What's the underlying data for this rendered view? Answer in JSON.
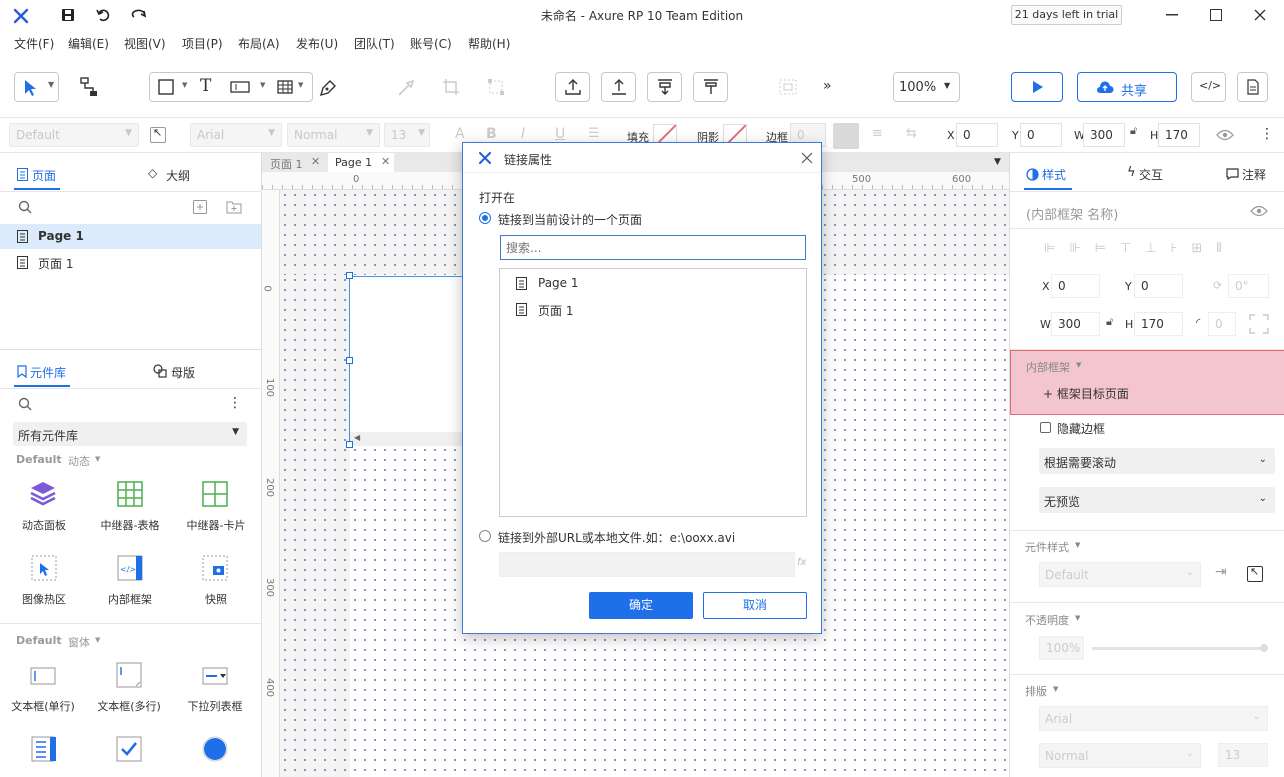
{
  "window": {
    "title": "未命名 - Axure RP 10 Team Edition",
    "trial": "21 days left in trial"
  },
  "menu": [
    "文件(F)",
    "编辑(E)",
    "视图(V)",
    "项目(P)",
    "布局(A)",
    "发布(U)",
    "团队(T)",
    "账号(C)",
    "帮助(H)"
  ],
  "toolbar": {
    "zoom": "100%",
    "share": "共享"
  },
  "format": {
    "style": "Default",
    "font": "Arial",
    "weight": "Normal",
    "size": "13",
    "fill": "填充",
    "shadow": "阴影",
    "border": "边框",
    "border_val": "0",
    "x_label": "X",
    "x": "0",
    "y_label": "Y",
    "y": "0",
    "w_label": "W",
    "w": "300",
    "h_label": "H",
    "h": "170"
  },
  "pages_panel": {
    "tab_pages": "页面",
    "tab_outline": "大纲",
    "pages": [
      "Page 1",
      "页面 1"
    ]
  },
  "library_panel": {
    "tab_library": "元件库",
    "tab_masters": "母版",
    "library_select": "所有元件库",
    "group1": {
      "name": "Default",
      "sub": "动态"
    },
    "group1_items": [
      "动态面板",
      "中继器-表格",
      "中继器-卡片",
      "图像热区",
      "内部框架",
      "快照"
    ],
    "group2": {
      "name": "Default",
      "sub": "窗体"
    },
    "group2_items": [
      "文本框(单行)",
      "文本框(多行)",
      "下拉列表框"
    ]
  },
  "canvas": {
    "tabs": [
      "页面 1",
      "Page 1"
    ],
    "ruler_h": [
      "0",
      "500",
      "600"
    ],
    "ruler_v": [
      "0",
      "100",
      "200",
      "300",
      "400"
    ]
  },
  "dialog": {
    "title": "链接属性",
    "section": "打开在",
    "option1": "链接到当前设计的一个页面",
    "search_placeholder": "搜索...",
    "pages": [
      "Page 1",
      "页面 1"
    ],
    "option2": "链接到外部URL或本地文件.如：e:\\ooxx.avi",
    "fx": "fx",
    "ok": "确定",
    "cancel": "取消"
  },
  "right_panel": {
    "tab_style": "样式",
    "tab_interact": "交互",
    "tab_notes": "注释",
    "name_placeholder": "(内部框架 名称)",
    "x_label": "X",
    "x": "0",
    "y_label": "Y",
    "y": "0",
    "rot": "0°",
    "w_label": "W",
    "w": "300",
    "h_label": "H",
    "h": "170",
    "radius": "0",
    "section_iframe": "内部框架",
    "frame_target": "+ 框架目标页面",
    "hide_border": "隐藏边框",
    "scroll": "根据需要滚动",
    "preview": "无预览",
    "section_widget_style": "元件样式",
    "widget_style": "Default",
    "section_opacity": "不透明度",
    "opacity": "100%",
    "section_typography": "排版",
    "font": "Arial",
    "weight": "Normal",
    "size": "13"
  },
  "colors": {
    "accent": "#1e6fe8",
    "highlight": "#f2c6cc",
    "highlight_border": "#e06a78"
  }
}
